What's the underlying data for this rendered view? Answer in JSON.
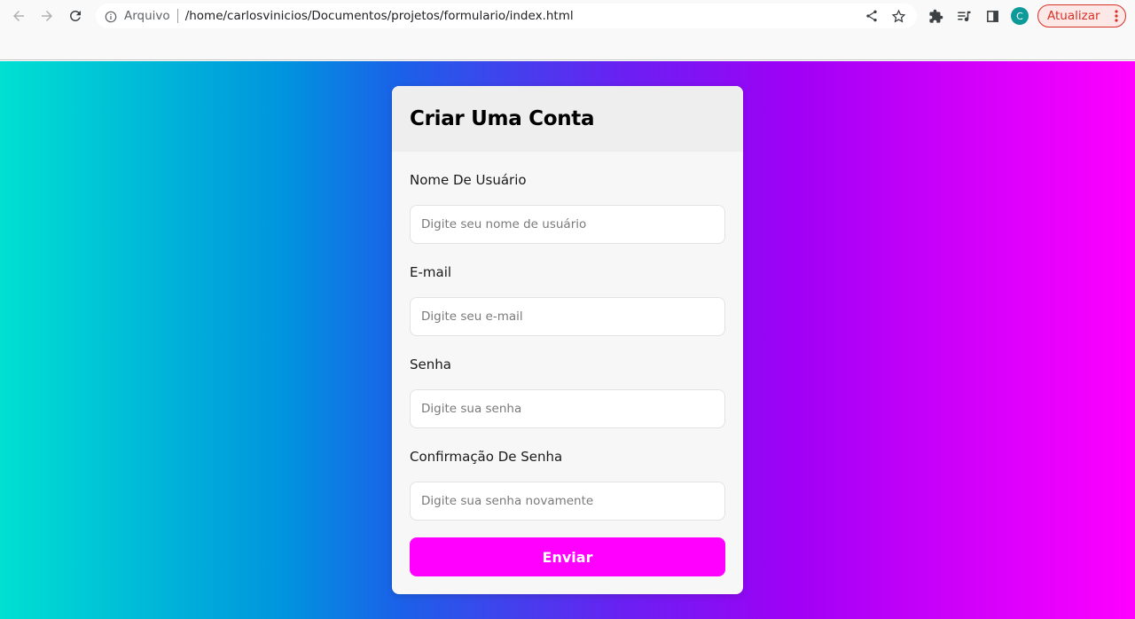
{
  "browser": {
    "address_scheme": "Arquivo",
    "address_url": "/home/carlosvinicios/Documentos/projetos/formulario/index.html",
    "avatar_letter": "C",
    "update_label": "Atualizar",
    "icons": [
      "back-icon",
      "forward-icon",
      "reload-icon",
      "info-icon",
      "share-icon",
      "star-icon",
      "extensions-icon",
      "reading-list-icon",
      "side-panel-icon",
      "menu-icon"
    ]
  },
  "form": {
    "title": "Criar Uma Conta",
    "fields": [
      {
        "label": "Nome De Usuário",
        "placeholder": "Digite seu nome de usuário"
      },
      {
        "label": "E-mail",
        "placeholder": "Digite seu e-mail"
      },
      {
        "label": "Senha",
        "placeholder": "Digite sua senha"
      },
      {
        "label": "Confirmação De Senha",
        "placeholder": "Digite sua senha novamente"
      }
    ],
    "submit_label": "Enviar"
  },
  "colors": {
    "accent": "#ff00ff",
    "gradient": [
      "#00e0d2",
      "#0094de",
      "#1a62e8",
      "#6a20f2",
      "#a000f6",
      "#ff00ff"
    ],
    "update_red": "#d93025"
  }
}
